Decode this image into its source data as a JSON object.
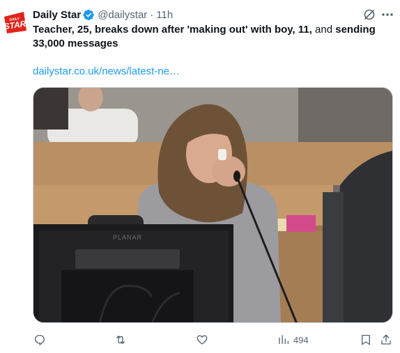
{
  "tweet": {
    "author_name": "Daily Star",
    "handle": "@dailystar",
    "separator": "·",
    "time": "11h",
    "text_part1": "Teacher, 25, breaks down after 'making out' with boy, 11,",
    "text_part2": " and ",
    "text_part3": "sending 33,000 messages",
    "link": "dailystar.co.uk/news/latest-ne…",
    "avatar_logo_small": "DAILY",
    "avatar_logo_big": "STAR",
    "monitor_brand": "PLANAR"
  },
  "actions": {
    "views": "494"
  },
  "icons": {
    "avatar": "daily-star-logo",
    "verified": "verified-badge-icon",
    "grok": "grok-icon",
    "more": "more-icon",
    "reply": "reply-icon",
    "retweet": "retweet-icon",
    "like": "like-icon",
    "views": "views-icon",
    "bookmark": "bookmark-icon",
    "share": "share-icon"
  },
  "colors": {
    "text": "#0f1419",
    "secondary": "#536471",
    "link": "#1d9bf0",
    "verified": "#1d9bf0",
    "brand_red": "#e2231a"
  }
}
